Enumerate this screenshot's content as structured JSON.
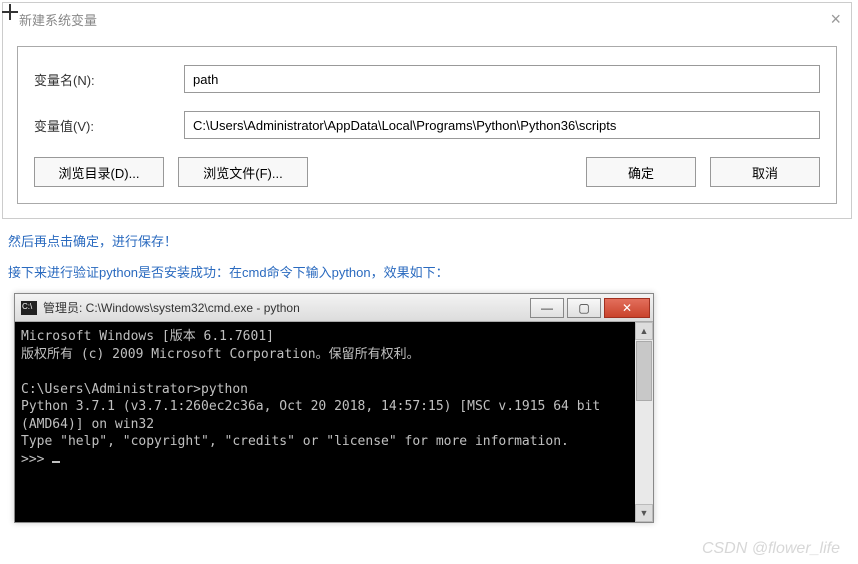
{
  "dialog": {
    "title": "新建系统变量",
    "labels": {
      "name": "变量名(N):",
      "value": "变量值(V):"
    },
    "fields": {
      "name": "path",
      "value": "C:\\Users\\Administrator\\AppData\\Local\\Programs\\Python\\Python36\\scripts"
    },
    "buttons": {
      "browse_dir": "浏览目录(D)...",
      "browse_file": "浏览文件(F)...",
      "ok": "确定",
      "cancel": "取消"
    }
  },
  "article": {
    "p1": "然后再点击确定，进行保存！",
    "p2": "接下来进行验证python是否安装成功：在cmd命令下输入python，效果如下："
  },
  "cmd": {
    "title": "管理员: C:\\Windows\\system32\\cmd.exe - python",
    "lines": {
      "l1": "Microsoft Windows [版本 6.1.7601]",
      "l2": "版权所有 (c) 2009 Microsoft Corporation。保留所有权利。",
      "l3": "",
      "l4": "C:\\Users\\Administrator>python",
      "l5": "Python 3.7.1 (v3.7.1:260ec2c36a, Oct 20 2018, 14:57:15) [MSC v.1915 64 bit (AMD64)] on win32",
      "l6": "Type \"help\", \"copyright\", \"credits\" or \"license\" for more information.",
      "l7": ">>> "
    },
    "window_buttons": {
      "min": "—",
      "max": "▢",
      "close": "✕"
    },
    "scroll": {
      "up": "▲",
      "down": "▼"
    }
  },
  "watermark": "CSDN @flower_life"
}
